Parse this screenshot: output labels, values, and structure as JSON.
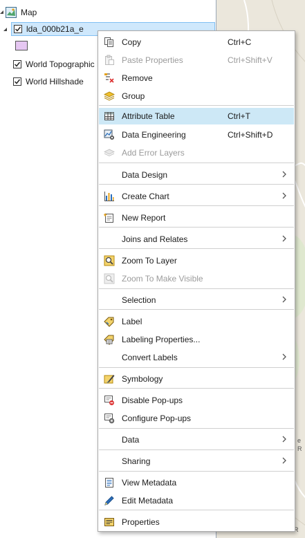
{
  "toc": {
    "map_label": "Map",
    "layers": [
      {
        "label": "lda_000b21a_e",
        "checked": true,
        "selected": true
      },
      {
        "label": "World Topographic Map",
        "checked": true
      },
      {
        "label": "World Hillshade",
        "checked": true
      }
    ],
    "swatch_color": "#e6c7f2"
  },
  "context_menu": {
    "copy": {
      "label": "Copy",
      "shortcut": "Ctrl+C"
    },
    "paste_properties": {
      "label": "Paste Properties",
      "shortcut": "Ctrl+Shift+V",
      "enabled": false
    },
    "remove": {
      "label": "Remove"
    },
    "group": {
      "label": "Group"
    },
    "attribute_table": {
      "label": "Attribute Table",
      "shortcut": "Ctrl+T",
      "highlighted": true
    },
    "data_engineering": {
      "label": "Data Engineering",
      "shortcut": "Ctrl+Shift+D"
    },
    "add_error_layers": {
      "label": "Add Error Layers",
      "enabled": false
    },
    "data_design": {
      "label": "Data Design"
    },
    "create_chart": {
      "label": "Create Chart"
    },
    "new_report": {
      "label": "New Report"
    },
    "joins_and_relates": {
      "label": "Joins and Relates"
    },
    "zoom_to_layer": {
      "label": "Zoom To Layer"
    },
    "zoom_to_make_visible": {
      "label": "Zoom To Make Visible",
      "enabled": false
    },
    "selection": {
      "label": "Selection"
    },
    "label": {
      "label": "Label"
    },
    "labeling_properties": {
      "label": "Labeling Properties..."
    },
    "convert_labels": {
      "label": "Convert Labels"
    },
    "symbology": {
      "label": "Symbology"
    },
    "disable_popups": {
      "label": "Disable Pop-ups"
    },
    "configure_popups": {
      "label": "Configure Pop-ups"
    },
    "data": {
      "label": "Data"
    },
    "sharing": {
      "label": "Sharing"
    },
    "view_metadata": {
      "label": "View Metadata"
    },
    "edit_metadata": {
      "label": "Edit Metadata"
    },
    "properties": {
      "label": "Properties"
    }
  },
  "colors": {
    "highlight": "#cde8f6",
    "selected_layer": "#cfe8fc",
    "disabled_text": "#9b9b9b"
  }
}
